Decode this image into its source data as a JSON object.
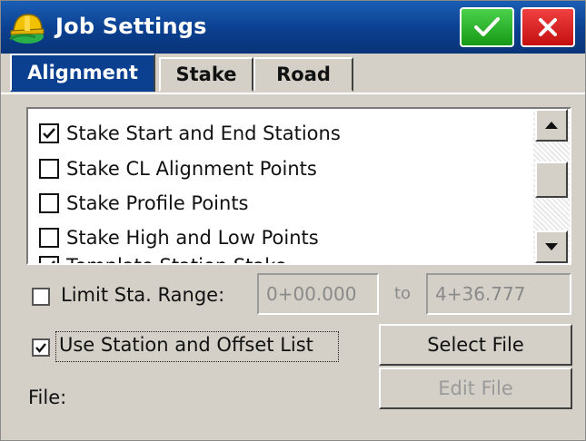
{
  "window": {
    "title": "Job Settings"
  },
  "tabs": [
    {
      "label": "Alignment",
      "active": true
    },
    {
      "label": "Stake",
      "active": false
    },
    {
      "label": "Road",
      "active": false
    }
  ],
  "list": {
    "items": [
      {
        "label": "Stake Start and End Stations",
        "checked": true
      },
      {
        "label": "Stake CL Alignment Points",
        "checked": false
      },
      {
        "label": "Stake Profile Points",
        "checked": false
      },
      {
        "label": "Stake High and Low Points",
        "checked": false
      },
      {
        "label": "Template Station Stake",
        "checked": true
      }
    ]
  },
  "range": {
    "label": "Limit Sta. Range:",
    "checked": false,
    "from_value": "0+00.000",
    "to_label": "to",
    "to_value": "4+36.777"
  },
  "offset_list": {
    "label": "Use Station and Offset List",
    "checked": true
  },
  "buttons": {
    "select_file": "Select File",
    "edit_file": "Edit File"
  },
  "file": {
    "label": "File:"
  },
  "colors": {
    "titlebar": "#0b3f8f",
    "ok": "#1fa51f",
    "close": "#d41818",
    "face": "#d4d0c8"
  }
}
